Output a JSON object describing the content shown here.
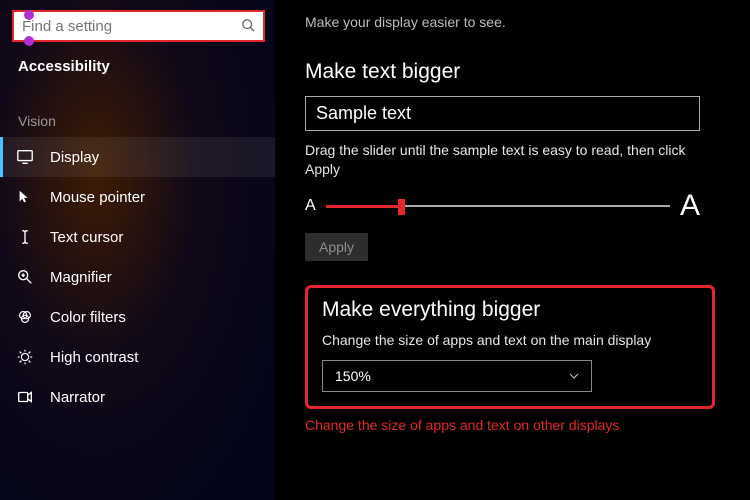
{
  "search": {
    "placeholder": "Find a setting"
  },
  "sidebar_title": "Accessibility",
  "section": "Vision",
  "nav": [
    {
      "label": "Display",
      "icon": "display-icon"
    },
    {
      "label": "Mouse pointer",
      "icon": "mouse-pointer-icon"
    },
    {
      "label": "Text cursor",
      "icon": "text-cursor-icon"
    },
    {
      "label": "Magnifier",
      "icon": "magnifier-icon"
    },
    {
      "label": "Color filters",
      "icon": "color-filters-icon"
    },
    {
      "label": "High contrast",
      "icon": "high-contrast-icon"
    },
    {
      "label": "Narrator",
      "icon": "narrator-icon"
    }
  ],
  "main": {
    "intro": "Make your display easier to see.",
    "section1_heading": "Make text bigger",
    "sample_text": "Sample text",
    "slider_desc": "Drag the slider until the sample text is easy to read, then click Apply",
    "a_small": "A",
    "a_big": "A",
    "apply": "Apply",
    "section2_heading": "Make everything bigger",
    "section2_desc": "Change the size of apps and text on the main display",
    "scale_value": "150%",
    "footer_link": "Change the size of apps and text on other displays"
  }
}
